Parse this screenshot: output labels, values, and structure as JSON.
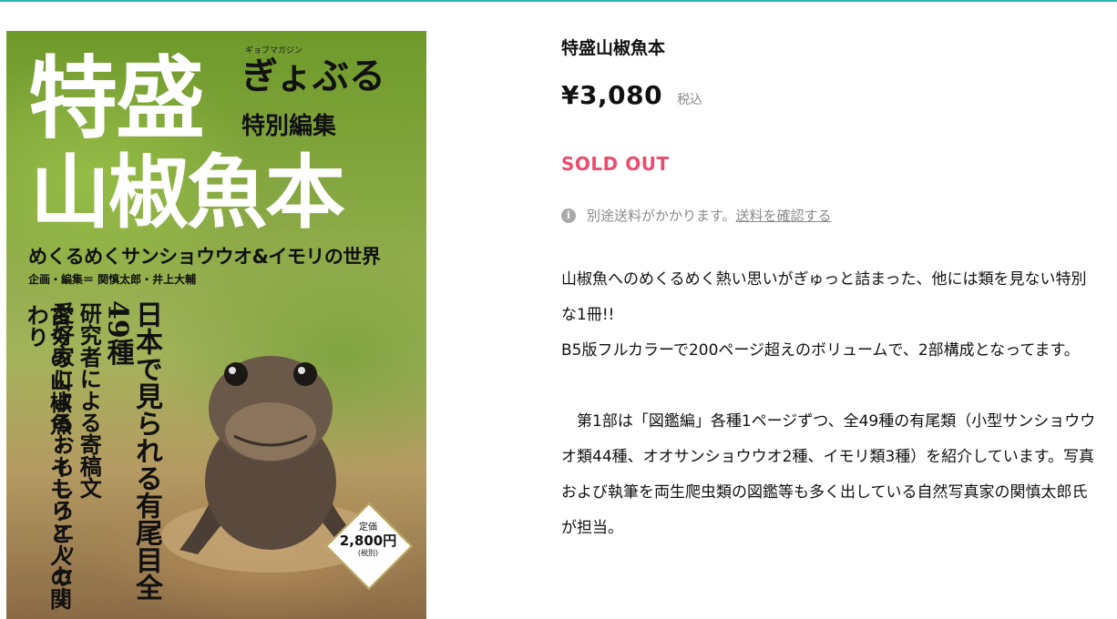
{
  "cover": {
    "title_line1": "特盛",
    "title_line2": "山椒魚本",
    "brand_kana": "ギョブマガジン",
    "brand": "ぎょぶる",
    "special": "特別編集",
    "subtitle": "めくるめくサンショウウオ&イモリの世界",
    "editors": "企画・編集＝ 関慎太郎・井上大輔",
    "vertical_lines": [
      "日本で見られる有尾目全49種",
      "研究者による寄稿文",
      "愛好家によるおもしろエッセー",
      "古今の山椒魚・イモリと人の関わり"
    ],
    "price_label": "定価",
    "price_value": "2,800円",
    "price_note": "(税別)"
  },
  "product": {
    "title": "特盛山椒魚本",
    "price": "¥3,080",
    "tax_label": "税込",
    "sold_out": "SOLD OUT",
    "shipping_text": "別途送料がかかります。",
    "shipping_link": "送料を確認する",
    "description": [
      "山椒魚へのめくるめく熱い思いがぎゅっと詰まった、他には類を見ない特別な1冊!!",
      "B5版フルカラーで200ページ超えのボリュームで、2部構成となってます。",
      "",
      "　第1部は「図鑑編」各種1ページずつ、全49種の有尾類（小型サンショウウオ類44種、オオサンショウウオ2種、イモリ類3種）を紹介しています。写真および執筆を両生爬虫類の図鑑等も多く出している自然写真家の関慎太郎氏が担当。"
    ]
  },
  "colors": {
    "accent_top_rule": "#2ab8b0",
    "sold_out": "#ec4d6e"
  }
}
